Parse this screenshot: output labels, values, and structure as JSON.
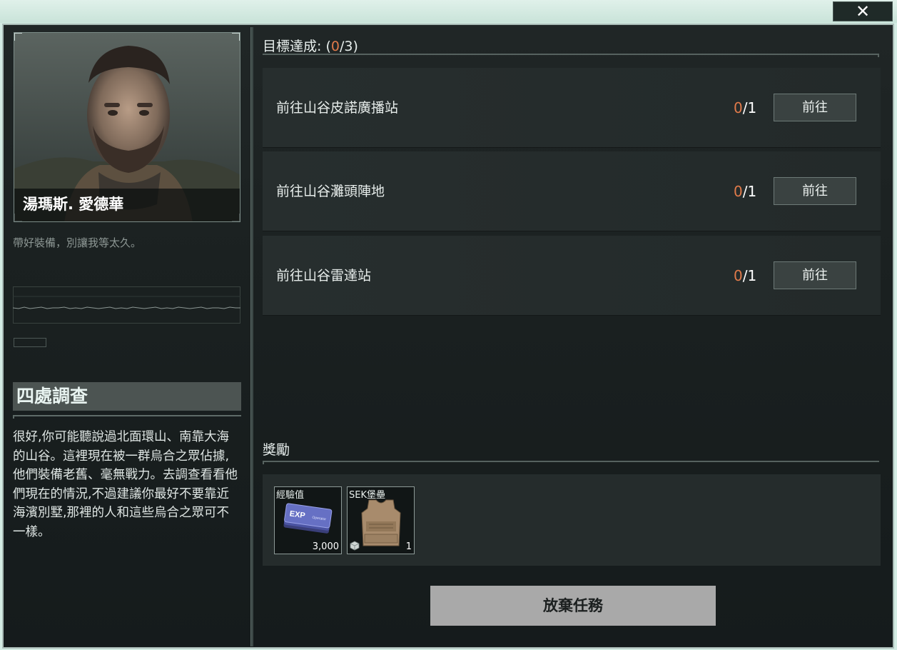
{
  "window": {
    "close_symbol": "✕",
    "colors": {
      "accent": "#e07a4a",
      "panel_bg": "#1b2121",
      "frame": "#a9bbb6",
      "button_bg": "#3a4241",
      "abandon_bg": "#a9a9a9"
    }
  },
  "npc": {
    "name": "湯瑪斯. 愛德華",
    "quote": "帶好裝備，別讓我等太久。"
  },
  "mission": {
    "title": "四處調查",
    "description": "很好,你可能聽說過北面環山、南靠大海的山谷。這裡現在被一群烏合之眾佔據,他們裝備老舊、毫無戰力。去調查看看他們現在的情況,不過建議你最好不要靠近海濱別墅,那裡的人和這些烏合之眾可不一樣。"
  },
  "objectives": {
    "header_label": "目標達成:",
    "header_open": "(",
    "done": "0",
    "total": "/3",
    "header_close": ")",
    "items": [
      {
        "text": "前往山谷皮諾廣播站",
        "done": "0",
        "total": "/1",
        "button": "前往"
      },
      {
        "text": "前往山谷灘頭陣地",
        "done": "0",
        "total": "/1",
        "button": "前往"
      },
      {
        "text": "前往山谷雷達站",
        "done": "0",
        "total": "/1",
        "button": "前往"
      }
    ]
  },
  "rewards": {
    "label": "獎勵",
    "items": [
      {
        "name": "經驗值",
        "quantity": "3,000",
        "icon": "exp-card-icon"
      },
      {
        "name": "SEK堡壘",
        "quantity": "1",
        "icon": "body-armor-icon"
      }
    ]
  },
  "actions": {
    "abandon": "放棄任務"
  }
}
